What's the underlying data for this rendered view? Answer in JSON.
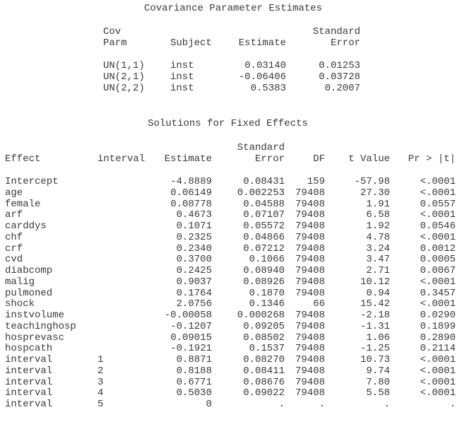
{
  "covariance": {
    "title": "Covariance Parameter Estimates",
    "headers": {
      "cov_parm_line1": "Cov",
      "cov_parm_line2": "Parm",
      "subject": "Subject",
      "estimate": "Estimate",
      "std_error_line1": "Standard",
      "std_error_line2": "Error"
    },
    "rows": [
      {
        "parm": "UN(1,1)",
        "subject": "inst",
        "estimate": "0.03140",
        "std_error": "0.01253"
      },
      {
        "parm": "UN(2,1)",
        "subject": "inst",
        "estimate": "-0.06406",
        "std_error": "0.03728"
      },
      {
        "parm": "UN(2,2)",
        "subject": "inst",
        "estimate": "0.5383",
        "std_error": "0.2007"
      }
    ]
  },
  "fixed_effects": {
    "title": "Solutions for Fixed Effects",
    "headers": {
      "effect": "Effect",
      "interval": "interval",
      "estimate": "Estimate",
      "std_error_line1": "Standard",
      "std_error_line2": "Error",
      "df": "DF",
      "t_value": "t Value",
      "p_value": "Pr > |t|"
    },
    "rows": [
      {
        "effect": "Intercept",
        "interval": "",
        "estimate": "-4.8889",
        "std_error": "0.08431",
        "df": "159",
        "t_value": "-57.98",
        "p_value": "<.0001"
      },
      {
        "effect": "age",
        "interval": "",
        "estimate": "0.06149",
        "std_error": "0.002253",
        "df": "79408",
        "t_value": "27.30",
        "p_value": "<.0001"
      },
      {
        "effect": "female",
        "interval": "",
        "estimate": "0.08778",
        "std_error": "0.04588",
        "df": "79408",
        "t_value": "1.91",
        "p_value": "0.0557"
      },
      {
        "effect": "arf",
        "interval": "",
        "estimate": "0.4673",
        "std_error": "0.07107",
        "df": "79408",
        "t_value": "6.58",
        "p_value": "<.0001"
      },
      {
        "effect": "carddys",
        "interval": "",
        "estimate": "0.1071",
        "std_error": "0.05572",
        "df": "79408",
        "t_value": "1.92",
        "p_value": "0.0546"
      },
      {
        "effect": "chf",
        "interval": "",
        "estimate": "0.2325",
        "std_error": "0.04866",
        "df": "79408",
        "t_value": "4.78",
        "p_value": "<.0001"
      },
      {
        "effect": "crf",
        "interval": "",
        "estimate": "0.2340",
        "std_error": "0.07212",
        "df": "79408",
        "t_value": "3.24",
        "p_value": "0.0012"
      },
      {
        "effect": "cvd",
        "interval": "",
        "estimate": "0.3700",
        "std_error": "0.1066",
        "df": "79408",
        "t_value": "3.47",
        "p_value": "0.0005"
      },
      {
        "effect": "diabcomp",
        "interval": "",
        "estimate": "0.2425",
        "std_error": "0.08940",
        "df": "79408",
        "t_value": "2.71",
        "p_value": "0.0067"
      },
      {
        "effect": "malig",
        "interval": "",
        "estimate": "0.9037",
        "std_error": "0.08926",
        "df": "79408",
        "t_value": "10.12",
        "p_value": "<.0001"
      },
      {
        "effect": "pulmoned",
        "interval": "",
        "estimate": "0.1764",
        "std_error": "0.1870",
        "df": "79408",
        "t_value": "0.94",
        "p_value": "0.3457"
      },
      {
        "effect": "shock",
        "interval": "",
        "estimate": "2.0756",
        "std_error": "0.1346",
        "df": "66",
        "t_value": "15.42",
        "p_value": "<.0001"
      },
      {
        "effect": "instvolume",
        "interval": "",
        "estimate": "-0.00058",
        "std_error": "0.000268",
        "df": "79408",
        "t_value": "-2.18",
        "p_value": "0.0290"
      },
      {
        "effect": "teachinghosp",
        "interval": "",
        "estimate": "-0.1207",
        "std_error": "0.09205",
        "df": "79408",
        "t_value": "-1.31",
        "p_value": "0.1899"
      },
      {
        "effect": "hosprevasc",
        "interval": "",
        "estimate": "0.09015",
        "std_error": "0.08502",
        "df": "79408",
        "t_value": "1.06",
        "p_value": "0.2890"
      },
      {
        "effect": "hospcath",
        "interval": "",
        "estimate": "-0.1921",
        "std_error": "0.1537",
        "df": "79408",
        "t_value": "-1.25",
        "p_value": "0.2114"
      },
      {
        "effect": "interval",
        "interval": "1",
        "estimate": "0.8871",
        "std_error": "0.08270",
        "df": "79408",
        "t_value": "10.73",
        "p_value": "<.0001"
      },
      {
        "effect": "interval",
        "interval": "2",
        "estimate": "0.8188",
        "std_error": "0.08411",
        "df": "79408",
        "t_value": "9.74",
        "p_value": "<.0001"
      },
      {
        "effect": "interval",
        "interval": "3",
        "estimate": "0.6771",
        "std_error": "0.08676",
        "df": "79408",
        "t_value": "7.80",
        "p_value": "<.0001"
      },
      {
        "effect": "interval",
        "interval": "4",
        "estimate": "0.5030",
        "std_error": "0.09022",
        "df": "79408",
        "t_value": "5.58",
        "p_value": "<.0001"
      },
      {
        "effect": "interval",
        "interval": "5",
        "estimate": "0",
        "std_error": ".",
        "df": ".",
        "t_value": ".",
        "p_value": "."
      }
    ]
  }
}
